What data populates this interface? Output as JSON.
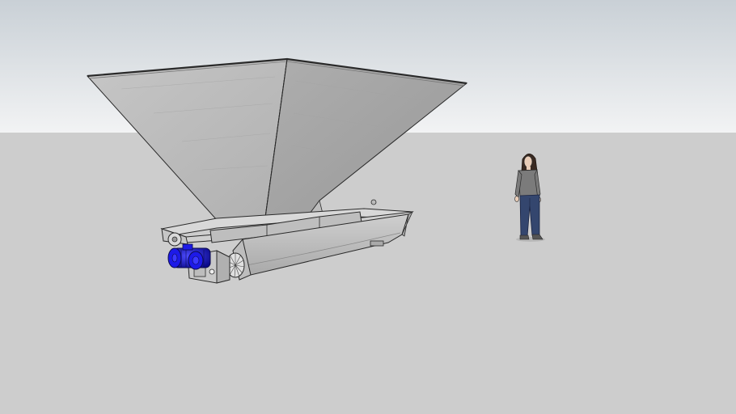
{
  "scene": {
    "colors": {
      "sky_top": "#c9d0d6",
      "sky_bottom": "#f2f3f4",
      "ground": "#cdcdcd",
      "steel_light": "#c9c9c9",
      "steel_mid": "#b3b3b3",
      "steel_dark": "#9a9a9a",
      "edge": "#2a2a2a",
      "motor_blue": "#1d1ae8",
      "motor_blue_dark": "#0b0a8a",
      "shirt": "#7b7b7b",
      "jeans": "#34466e",
      "hair": "#3a2a22",
      "skin": "#e9cdb8"
    },
    "objects": [
      "sky",
      "ground-plane",
      "hopper",
      "screw-conveyor-trough",
      "drive-motor",
      "scale-figure-person"
    ]
  }
}
